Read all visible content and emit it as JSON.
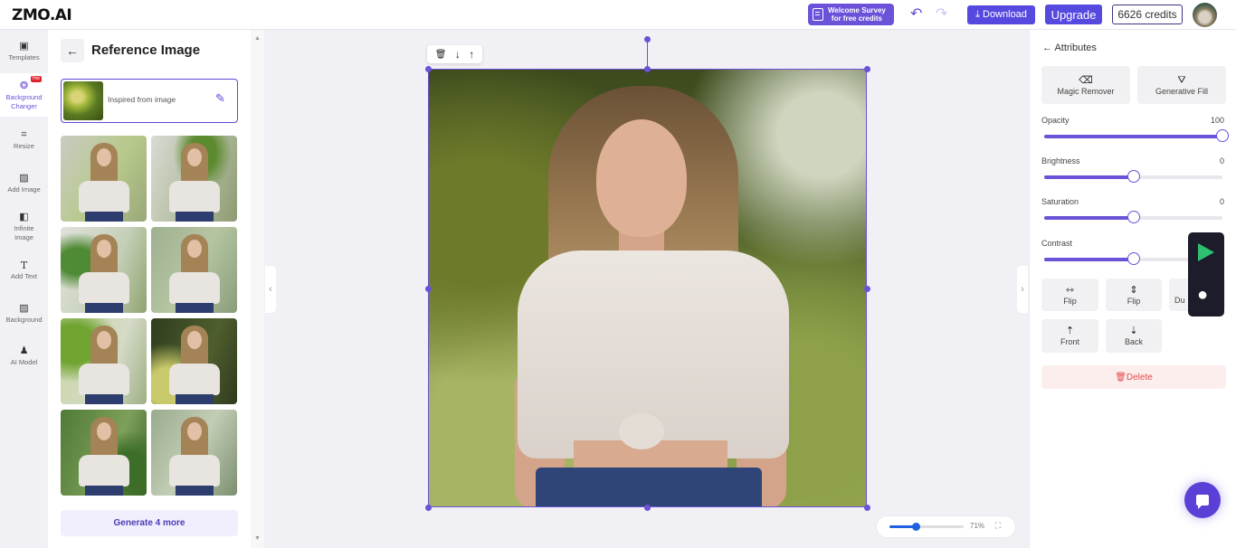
{
  "header": {
    "logo": "ZMO.AI",
    "survey_label_line1": "Welcome Survey",
    "survey_label_line2": "for free credits",
    "undo_icon": "↶",
    "redo_icon": "↷",
    "download_label": "⤓ Download",
    "upgrade_label": "Upgrade",
    "credits_label": "6626 credits"
  },
  "leftnav": {
    "items": [
      {
        "label": "Templates",
        "icon": "▣"
      },
      {
        "label": "Background Changer",
        "icon": "❂",
        "badge": "Hot",
        "active": true
      },
      {
        "label": "Resize",
        "icon": "⌗"
      },
      {
        "label": "Add Image",
        "icon": "▨"
      },
      {
        "label": "Infinite Image",
        "icon": "◧"
      },
      {
        "label": "Add Text",
        "icon": "T"
      },
      {
        "label": "Background",
        "icon": "▨"
      },
      {
        "label": "AI Model",
        "icon": "♟"
      }
    ]
  },
  "panel": {
    "back_icon": "←",
    "title": "Reference Image",
    "reference_label": "Inspired from image",
    "edit_icon": "✎",
    "results": [
      {
        "variant": "light-green"
      },
      {
        "variant": "leaves-blur"
      },
      {
        "variant": "leaves-left"
      },
      {
        "variant": "soft-green"
      },
      {
        "variant": "leaves-bright"
      },
      {
        "variant": "dark-foliage"
      },
      {
        "variant": "green-forest"
      },
      {
        "variant": "muted-green"
      }
    ],
    "generate_label": "Generate 4 more"
  },
  "canvas": {
    "toolbar": {
      "delete_icon": "🗑",
      "down_icon": "↓",
      "up_icon": "↑"
    },
    "collapse_left_icon": "‹",
    "collapse_right_icon": "›",
    "zoom_value": "71%",
    "zoom_fraction": 0.35,
    "fit_icon": "⛶"
  },
  "attributes": {
    "header": "← Attributes",
    "magic_remover": {
      "label": "Magic Remover",
      "icon": "⌫"
    },
    "generative_fill": {
      "label": "Generative Fill",
      "icon": "⛛"
    },
    "sliders": [
      {
        "label": "Opacity",
        "value": "100",
        "fraction": 1.0
      },
      {
        "label": "Brightness",
        "value": "0",
        "fraction": 0.5
      },
      {
        "label": "Saturation",
        "value": "0",
        "fraction": 0.5
      },
      {
        "label": "Contrast",
        "value": "",
        "fraction": 0.5
      }
    ],
    "actions": [
      {
        "label": "Flip",
        "icon": "⇿"
      },
      {
        "label": "Flip",
        "icon": "⇕"
      },
      {
        "label": "Du",
        "icon": ""
      },
      {
        "label": "Front",
        "icon": "⇡"
      },
      {
        "label": "Back",
        "icon": "⇣"
      }
    ],
    "delete_label": "🗑Delete"
  },
  "floating": {
    "play_store": "Google Play",
    "app_store": ""
  }
}
